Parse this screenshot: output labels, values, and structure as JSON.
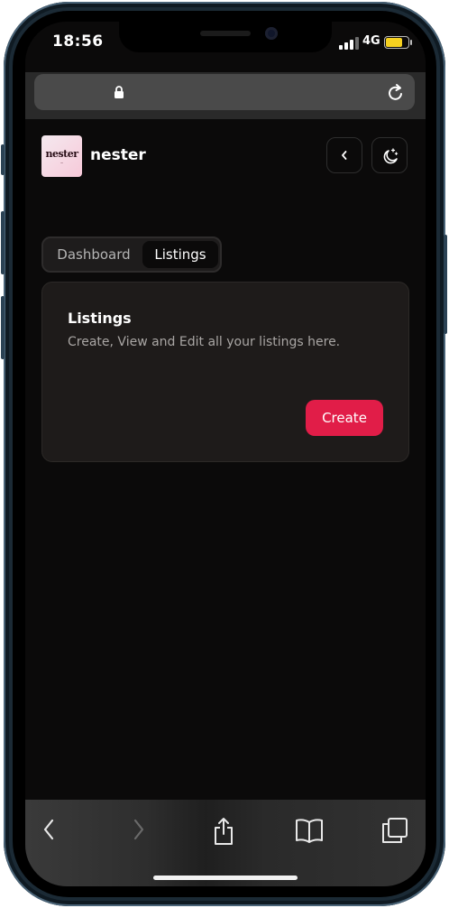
{
  "status_bar": {
    "time": "18:56",
    "network": "4G",
    "signal_icon": "signal-bars-icon",
    "battery_icon": "battery-icon",
    "battery_color": "#f5d020"
  },
  "browser": {
    "lock_icon": "lock-icon",
    "reload_icon": "reload-icon"
  },
  "header": {
    "logo_text": "nester",
    "app_name": "nester",
    "back_icon": "chevron-left-icon",
    "theme_icon": "moon-stars-icon"
  },
  "tabs": [
    {
      "label": "Dashboard",
      "active": false
    },
    {
      "label": "Listings",
      "active": true
    }
  ],
  "card": {
    "title": "Listings",
    "description": "Create, View and Edit all your listings here.",
    "create_label": "Create",
    "accent_color": "#e11d48"
  },
  "toolbar": {
    "items": [
      "back-icon",
      "forward-icon",
      "share-icon",
      "bookmarks-icon",
      "tabs-icon"
    ]
  }
}
